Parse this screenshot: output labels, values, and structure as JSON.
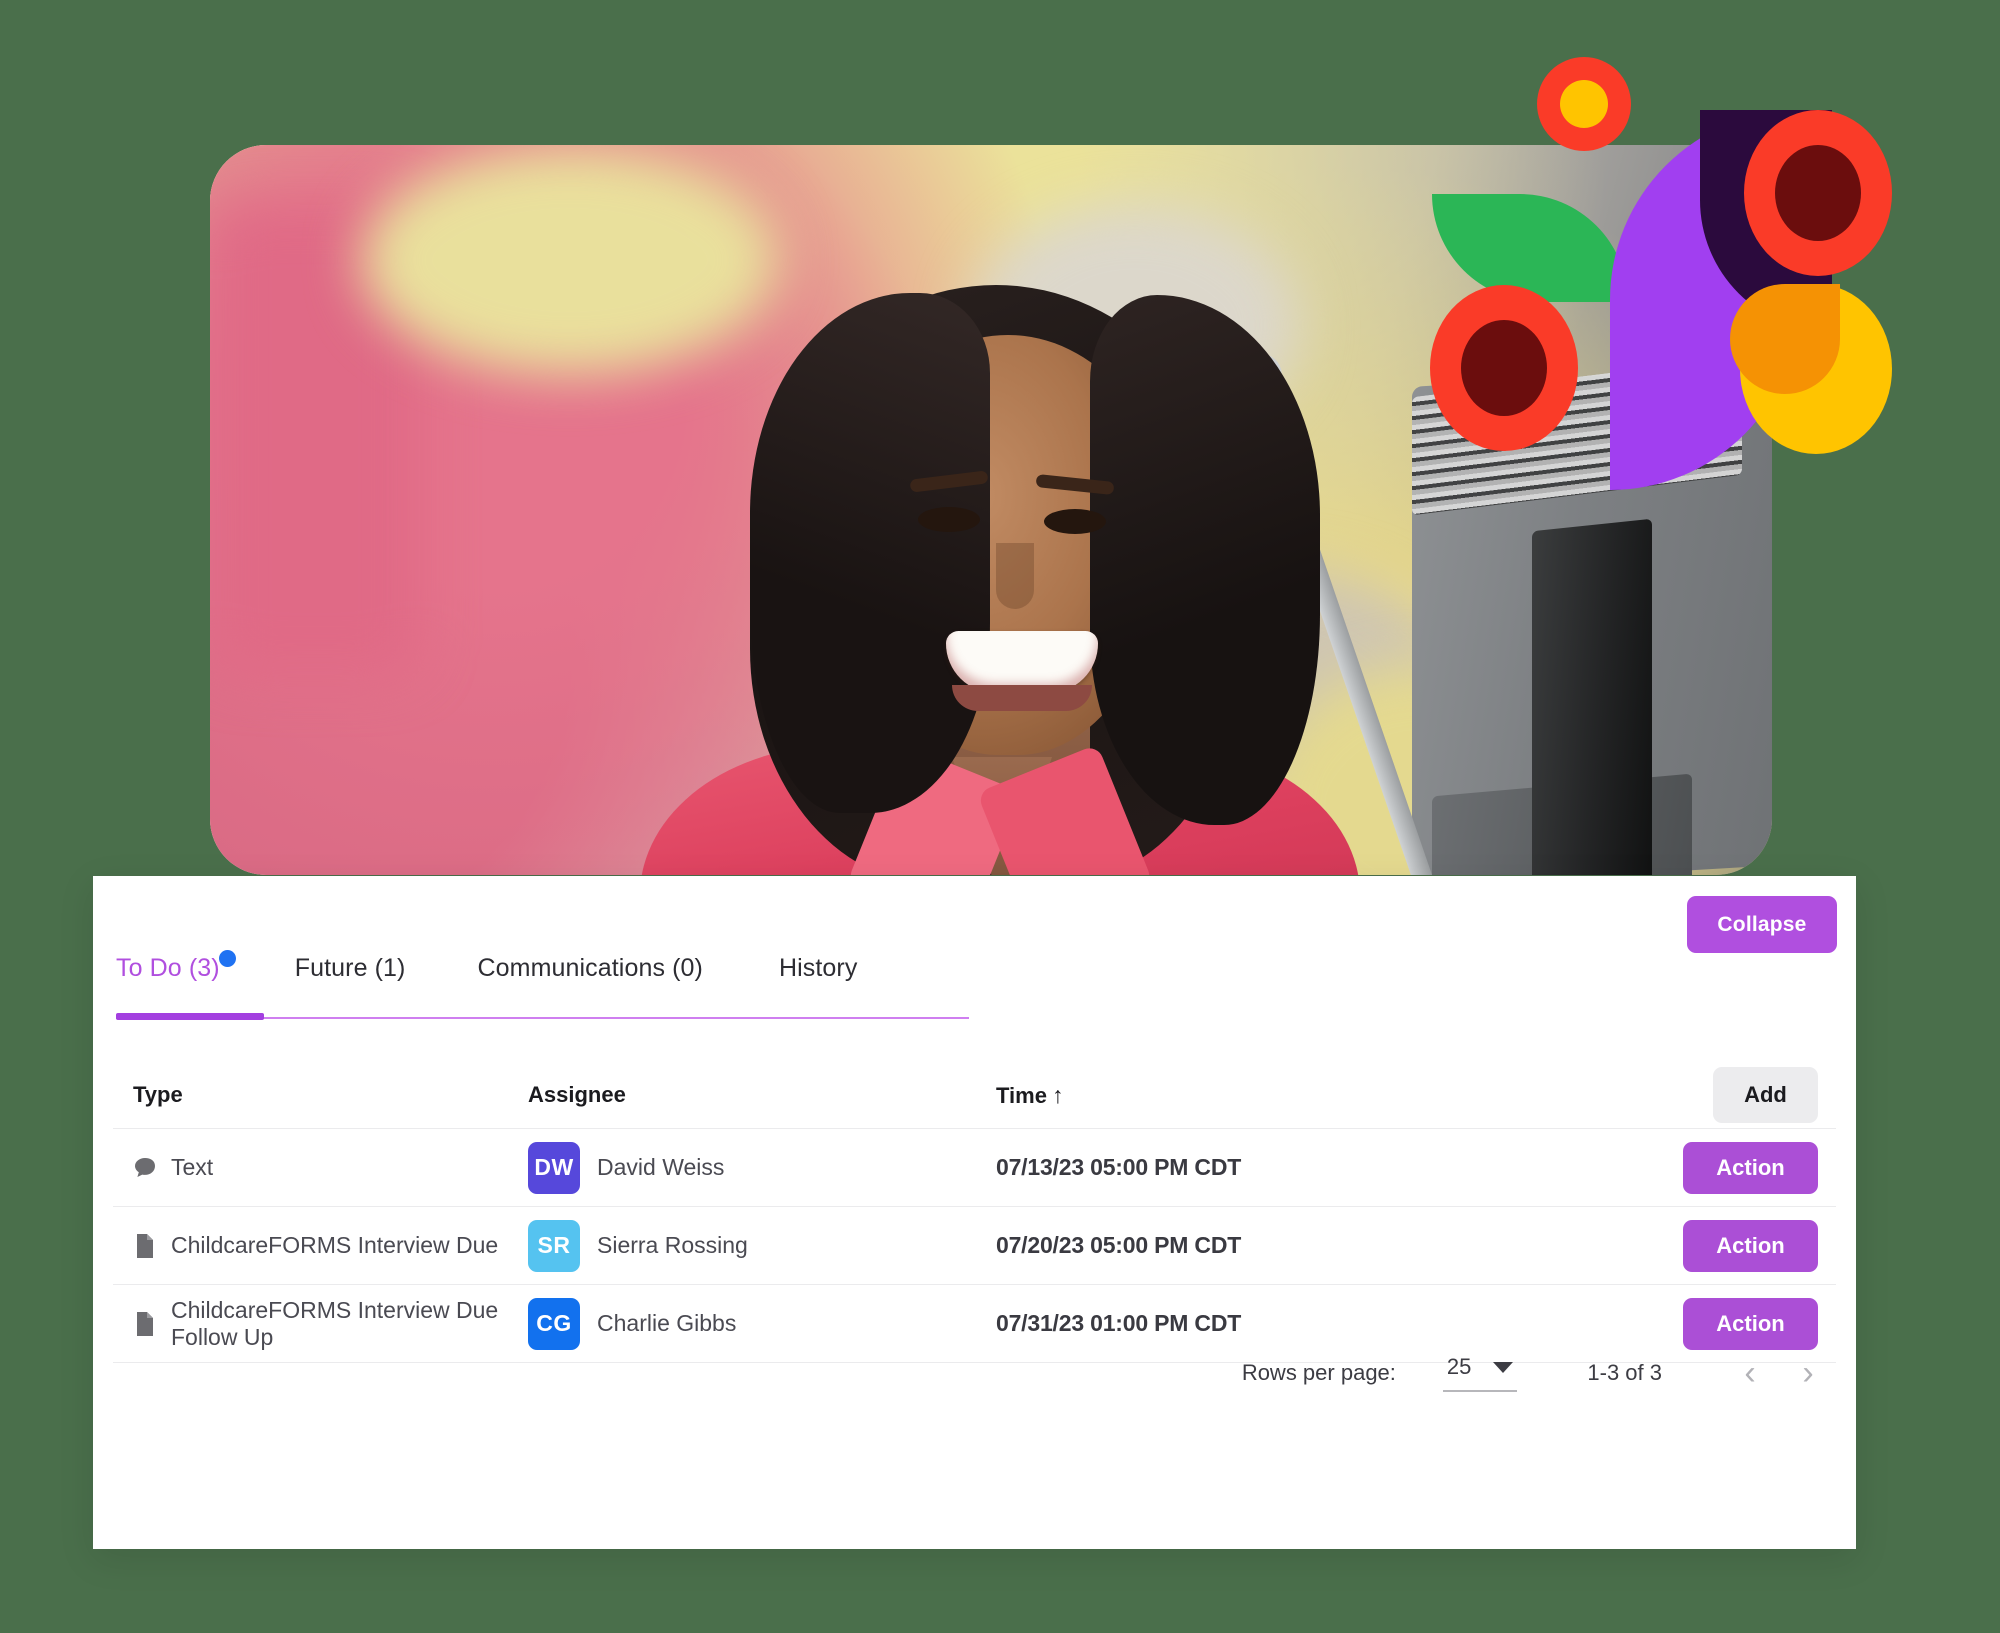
{
  "theme": {
    "page_background": "#4a6f4b",
    "accent_purple": "#b04fdf",
    "action_purple": "#ab4fd6",
    "tab_active": "#b04fdf",
    "notification_dot": "#1f72f2",
    "add_button_bg": "#ececee"
  },
  "decor": {
    "shapes": [
      {
        "name": "ring-red-yellow",
        "outer": "#fa3b28",
        "inner": "#ffc400"
      },
      {
        "name": "leaf-green",
        "color": "#2bb656"
      },
      {
        "name": "ring-red-maroon-left",
        "outer": "#fa3b28",
        "inner": "#6b0d0d"
      },
      {
        "name": "petal-purple",
        "color": "#a13ff0"
      },
      {
        "name": "petal-dark-plum",
        "color": "#2b0a3d"
      },
      {
        "name": "ring-red-maroon-right",
        "outer": "#fa3b28",
        "inner": "#6b0d0d"
      },
      {
        "name": "circle-yellow-orange",
        "outer": "#ffc400",
        "inner": "#f59204"
      }
    ]
  },
  "card": {
    "collapse_label": "Collapse",
    "tabs": [
      {
        "label": "To Do (3)",
        "active": true,
        "has_dot": true
      },
      {
        "label": "Future (1)",
        "active": false,
        "has_dot": false
      },
      {
        "label": "Communications (0)",
        "active": false,
        "has_dot": false
      },
      {
        "label": "History",
        "active": false,
        "has_dot": false
      }
    ],
    "table": {
      "headers": {
        "type": "Type",
        "assignee": "Assignee",
        "time": "Time",
        "sort_arrow": "↑"
      },
      "add_label": "Add",
      "rows": [
        {
          "icon": "chat-bubble-icon",
          "type": "Text",
          "initials": "DW",
          "avatar_color": "#5648db",
          "name": "David Weiss",
          "time": "07/13/23 05:00 PM CDT",
          "action_label": "Action"
        },
        {
          "icon": "document-icon",
          "type": "ChildcareFORMS Interview Due",
          "initials": "SR",
          "avatar_color": "#55c3f0",
          "name": "Sierra Rossing",
          "time": "07/20/23 05:00 PM CDT",
          "action_label": "Action"
        },
        {
          "icon": "document-icon",
          "type": "ChildcareFORMS Interview Due Follow Up",
          "initials": "CG",
          "avatar_color": "#1271ee",
          "name": "Charlie Gibbs",
          "time": "07/31/23 01:00 PM CDT",
          "action_label": "Action"
        }
      ]
    },
    "pagination": {
      "rows_per_page_label": "Rows per page:",
      "rows_per_page_value": "25",
      "range_label": "1-3 of 3",
      "prev_glyph": "‹",
      "next_glyph": "›"
    }
  }
}
